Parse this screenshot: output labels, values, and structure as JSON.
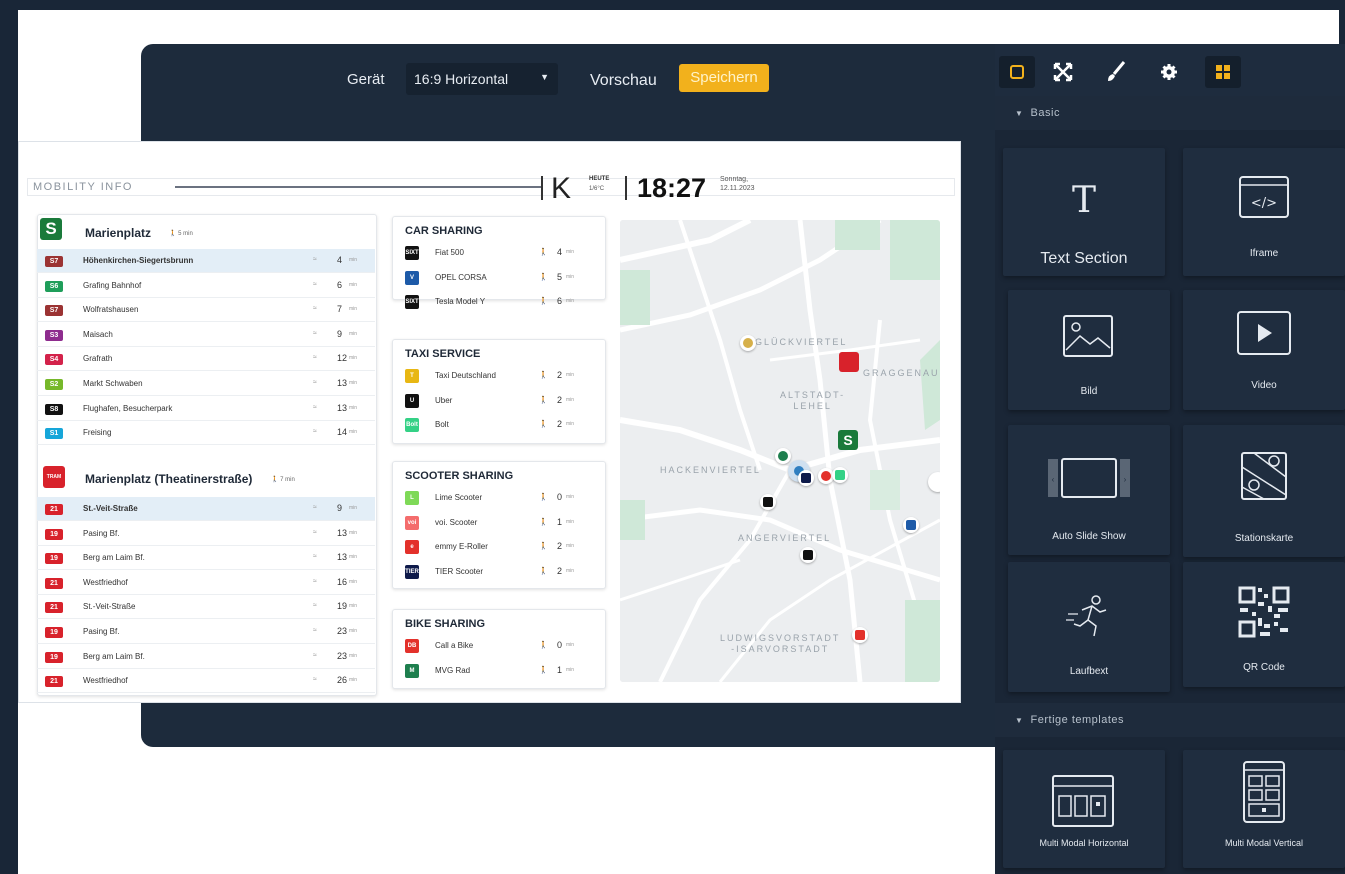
{
  "toolbar": {
    "device_label": "Gerät",
    "device_value": "16:9 Horizontal",
    "preview_label": "Vorschau",
    "save_label": "Speichern"
  },
  "preview": {
    "header": {
      "mobility_info": "MOBILITY INFO",
      "weather_letter": "K",
      "today_label": "HEUTE",
      "temperature": "1/6°C",
      "time": "18:27",
      "weekday": "Sonntag,",
      "date": "12.11.2023"
    },
    "stations": [
      {
        "name": "Marienplatz",
        "sub": "🚶 5 min",
        "departures": [
          {
            "line": "S7",
            "color": "#9b3333",
            "dest": "Höhenkirchen-Siegertsbrunn",
            "min": "4"
          },
          {
            "line": "S6",
            "color": "#1f9e5a",
            "dest": "Grafing Bahnhof",
            "min": "6"
          },
          {
            "line": "S7",
            "color": "#9b3333",
            "dest": "Wolfratshausen",
            "min": "7"
          },
          {
            "line": "S3",
            "color": "#8e2c8e",
            "dest": "Maisach",
            "min": "9"
          },
          {
            "line": "S4",
            "color": "#d3224a",
            "dest": "Grafrath",
            "min": "12"
          },
          {
            "line": "S2",
            "color": "#76b82a",
            "dest": "Markt Schwaben",
            "min": "13"
          },
          {
            "line": "S8",
            "color": "#111111",
            "dest": "Flughafen, Besucherpark",
            "min": "13"
          },
          {
            "line": "S1",
            "color": "#16a6d9",
            "dest": "Freising",
            "min": "14"
          }
        ]
      },
      {
        "name": "Marienplatz (Theatinerstraße)",
        "sub": "🚶 7 min",
        "departures": [
          {
            "line": "21",
            "color": "#d8222b",
            "dest": "St.-Veit-Straße",
            "min": "9"
          },
          {
            "line": "19",
            "color": "#d8222b",
            "dest": "Pasing Bf.",
            "min": "13"
          },
          {
            "line": "19",
            "color": "#d8222b",
            "dest": "Berg am Laim Bf.",
            "min": "13"
          },
          {
            "line": "21",
            "color": "#d8222b",
            "dest": "Westfriedhof",
            "min": "16"
          },
          {
            "line": "21",
            "color": "#d8222b",
            "dest": "St.-Veit-Straße",
            "min": "19"
          },
          {
            "line": "19",
            "color": "#d8222b",
            "dest": "Pasing Bf.",
            "min": "23"
          },
          {
            "line": "19",
            "color": "#d8222b",
            "dest": "Berg am Laim Bf.",
            "min": "23"
          },
          {
            "line": "21",
            "color": "#d8222b",
            "dest": "Westfriedhof",
            "min": "26"
          }
        ]
      }
    ],
    "services": [
      {
        "title": "CAR SHARING",
        "items": [
          {
            "name": "Fiat 500",
            "logo": "SIXT",
            "color": "#111111",
            "val": "4"
          },
          {
            "name": "OPEL CORSA",
            "logo": "V",
            "color": "#1d5aa8",
            "val": "5"
          },
          {
            "name": "Tesla Model Y",
            "logo": "SIXT",
            "color": "#111111",
            "val": "6"
          }
        ]
      },
      {
        "title": "TAXI SERVICE",
        "items": [
          {
            "name": "Taxi Deutschland",
            "logo": "T",
            "color": "#e8b713",
            "val": "2"
          },
          {
            "name": "Uber",
            "logo": "U",
            "color": "#111111",
            "val": "2"
          },
          {
            "name": "Bolt",
            "logo": "Bolt",
            "color": "#34d186",
            "val": "2"
          }
        ]
      },
      {
        "title": "SCOOTER SHARING",
        "items": [
          {
            "name": "Lime Scooter",
            "logo": "L",
            "color": "#7ed957",
            "val": "0"
          },
          {
            "name": "voi. Scooter",
            "logo": "voi",
            "color": "#f46c6c",
            "val": "1"
          },
          {
            "name": "emmy E-Roller",
            "logo": "e",
            "color": "#e3312b",
            "val": "2"
          },
          {
            "name": "TIER Scooter",
            "logo": "TIER",
            "color": "#0e1a4a",
            "val": "2"
          }
        ]
      },
      {
        "title": "BIKE SHARING",
        "items": [
          {
            "name": "Call a Bike",
            "logo": "DB",
            "color": "#e3312b",
            "val": "0"
          },
          {
            "name": "MVG Rad",
            "logo": "M",
            "color": "#1e7f4e",
            "val": "1"
          }
        ]
      }
    ],
    "map_labels": {
      "glockenbach": "GLÜCKVIERTEL",
      "graggenau": "GRAGGENAU",
      "altstadt": "ALTSTADT-\nLEHEL",
      "hackenviertel": "HACKENVIERTEL",
      "angerviertel": "ANGERVIERTEL",
      "ludwigsvorstadt": "LUDWIGSVORSTADT\n-ISARVORSTADT"
    }
  },
  "sidebar": {
    "section_basic": "Basic",
    "section_templates": "Fertige templates",
    "tiles": {
      "text": "Text Section",
      "iframe": "Iframe",
      "bild": "Bild",
      "video": "Video",
      "slideshow": "Auto Slide Show",
      "stationskarte": "Stationskarte",
      "laufband": "Laufbext",
      "qrcode": "QR Code",
      "multi_h": "Multi Modal Horizontal",
      "multi_v": "Multi Modal Vertical"
    }
  },
  "colors": {
    "accent": "#f2b11c",
    "editor_bg": "#1d2b3c",
    "sidebar_bg": "#1a2636",
    "s_bahn": "#1a7a3b",
    "tram": "#d8222b"
  }
}
